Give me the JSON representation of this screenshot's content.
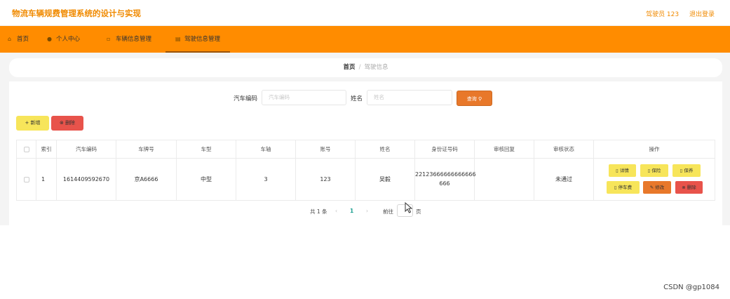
{
  "app": {
    "title": "物流车辆规费管理系统的设计与实现",
    "user": "驾驶员 123",
    "logout": "退出登录"
  },
  "nav": [
    {
      "label": "首页",
      "icon": "home-icon"
    },
    {
      "label": "个人中心",
      "icon": "user-icon"
    },
    {
      "label": "车辆信息管理",
      "icon": "vehicle-icon"
    },
    {
      "label": "驾驶信息管理",
      "icon": "document-icon"
    }
  ],
  "breadcrumb": {
    "home": "首页",
    "sep": "/",
    "current": "驾驶信息"
  },
  "search": {
    "car_code_label": "汽车编码",
    "car_code_placeholder": "汽车编码",
    "name_label": "姓名",
    "name_placeholder": "姓名",
    "query_label": "查询 ⚲"
  },
  "actions": {
    "add": "+ 新增",
    "delete": "⊗ 删除"
  },
  "table": {
    "headers": [
      "索引",
      "汽车编码",
      "车牌号",
      "车型",
      "车轴",
      "账号",
      "姓名",
      "身份证号码",
      "审核回复",
      "审核状态",
      "操作"
    ],
    "rows": [
      {
        "index": "1",
        "car_code": "1614409592670",
        "plate": "京A6666",
        "type": "中型",
        "axle": "3",
        "account": "123",
        "name": "吴毅",
        "id_line1": "22123666666666666",
        "id_line2": "666",
        "reply": "",
        "status": "未通过"
      }
    ],
    "ops": {
      "detail": "▯ 详情",
      "insurance": "▯ 保险",
      "maintenance": "▯ 保养",
      "parking": "▯ 停车费",
      "edit": "✎ 修改",
      "delete": "⊗ 删除"
    }
  },
  "pagination": {
    "total": "共 1 条",
    "prev": "‹",
    "page": "1",
    "next": "›",
    "goto_prefix": "前往",
    "goto_suffix": "页"
  },
  "watermark": "CSDN @gp1084"
}
